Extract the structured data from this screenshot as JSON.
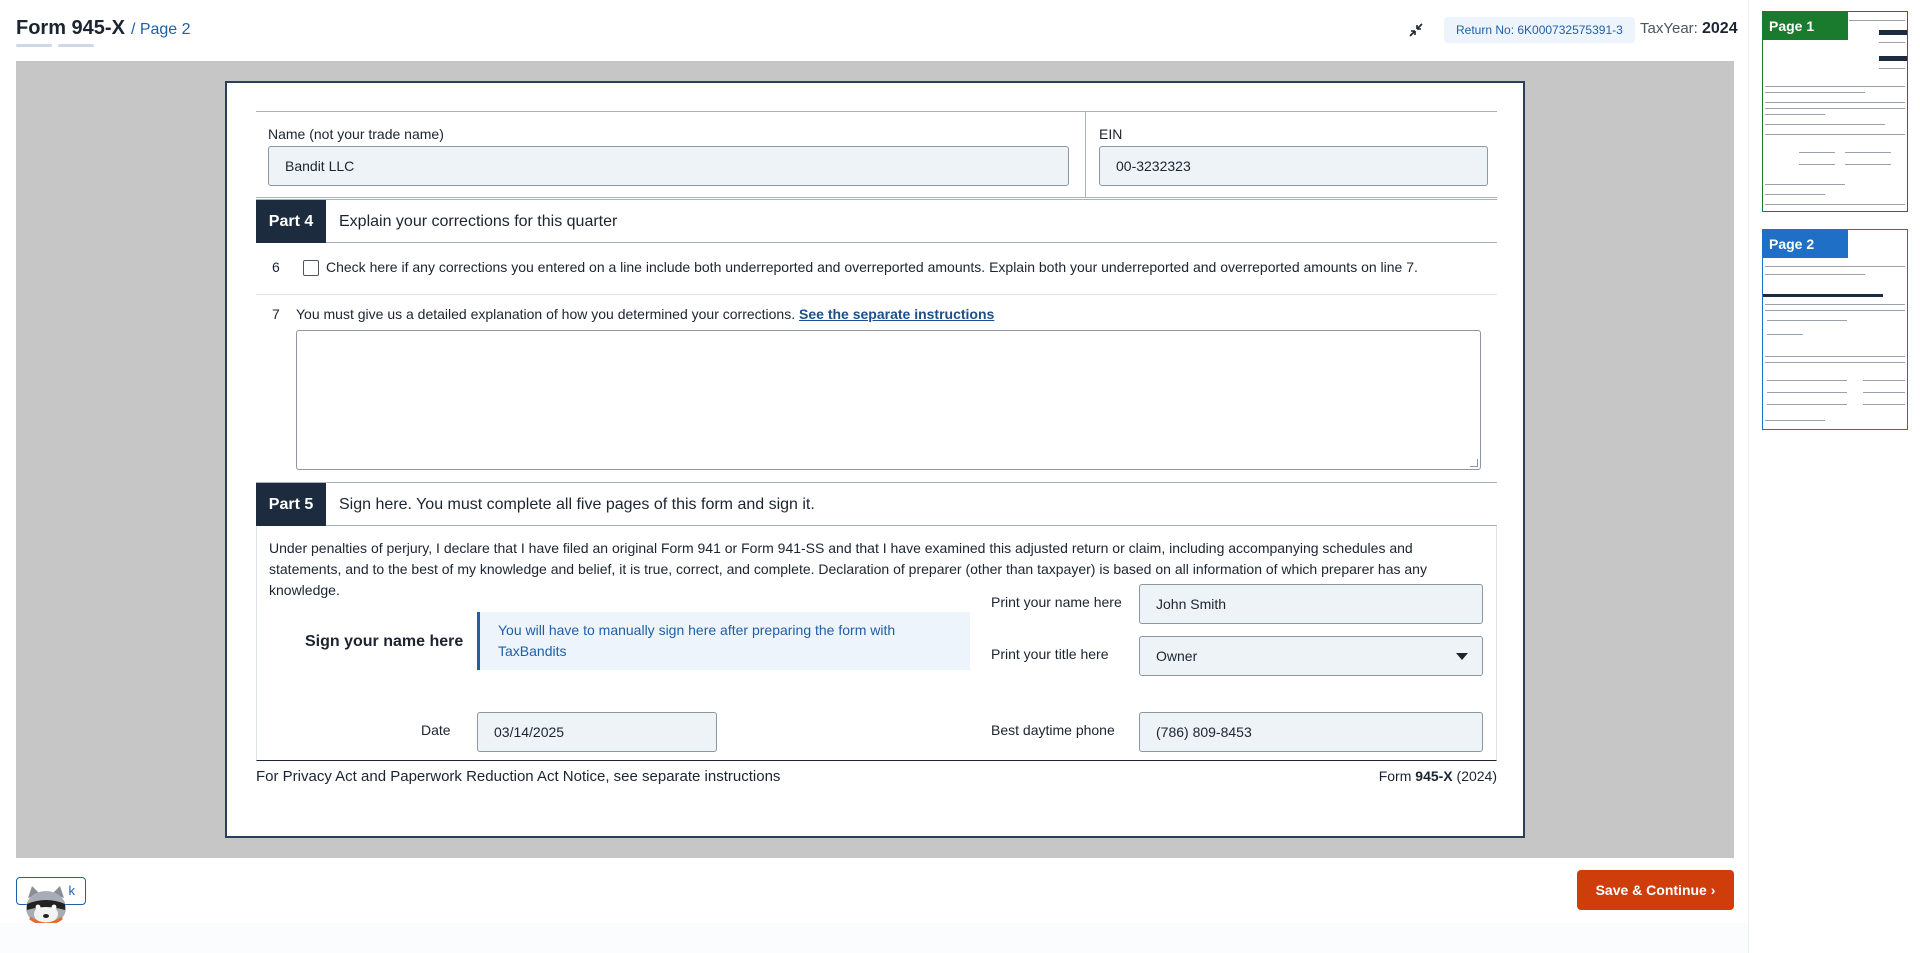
{
  "header": {
    "form_title": "Form 945-X",
    "page_crumb": "/ Page 2",
    "return_no": "Return No: 6K000732575391-3",
    "tax_year_label": "TaxYear:",
    "tax_year_value": "2024"
  },
  "identity": {
    "name_label": "Name (not your trade name)",
    "name_value": "Bandit LLC",
    "ein_label": "EIN",
    "ein_value": "00-3232323"
  },
  "part4": {
    "tag": "Part 4",
    "title": "Explain your corrections for this quarter",
    "line6_num": "6",
    "line6_bold": "Check here if any corrections you entered on a line include both underreported and overreported amounts.",
    "line6_rest": " Explain both your underreported and overreported amounts on line 7.",
    "line6_checked": false,
    "line7_num": "7",
    "line7_text": "You must give us a detailed explanation of how you determined your corrections. ",
    "line7_link": "See the separate instructions",
    "line7_value": ""
  },
  "part5": {
    "tag": "Part 5",
    "title": "Sign here. You must complete all five pages of this form and sign it.",
    "declaration": "Under penalties of perjury, I declare that I have filed an original Form 941 or Form 941-SS and that I have examined this adjusted return or claim, including accompanying schedules and statements, and to the best of my knowledge and belief, it is true, correct, and complete. Declaration of preparer (other than taxpayer) is based on all information of which preparer has any knowledge.",
    "sign_label": "Sign your name here",
    "sign_notice": "You will have to manually sign here after preparing the form with TaxBandits",
    "print_name_label": "Print your name here",
    "print_name_value": "John Smith",
    "print_title_label": "Print your title here",
    "print_title_value": "Owner",
    "date_label": "Date",
    "date_value": "03/14/2025",
    "phone_label": "Best daytime phone",
    "phone_value": "(786) 809-8453"
  },
  "footer": {
    "notice": "For Privacy Act and Paperwork Reduction Act Notice, see separate instructions",
    "form_prefix": "Form ",
    "form_name": "945-X",
    "form_year": " (2024)"
  },
  "thumbnails": [
    {
      "label": "Page 1",
      "color": "#1a7a2e"
    },
    {
      "label": "Page 2",
      "color": "#1f6fc7"
    }
  ],
  "actions": {
    "back_label": "k",
    "save_label": "Save & Continue ›"
  },
  "colors": {
    "accent": "#1f5fa8",
    "save": "#cf3e0a",
    "part_tag": "#1c2b3d"
  }
}
